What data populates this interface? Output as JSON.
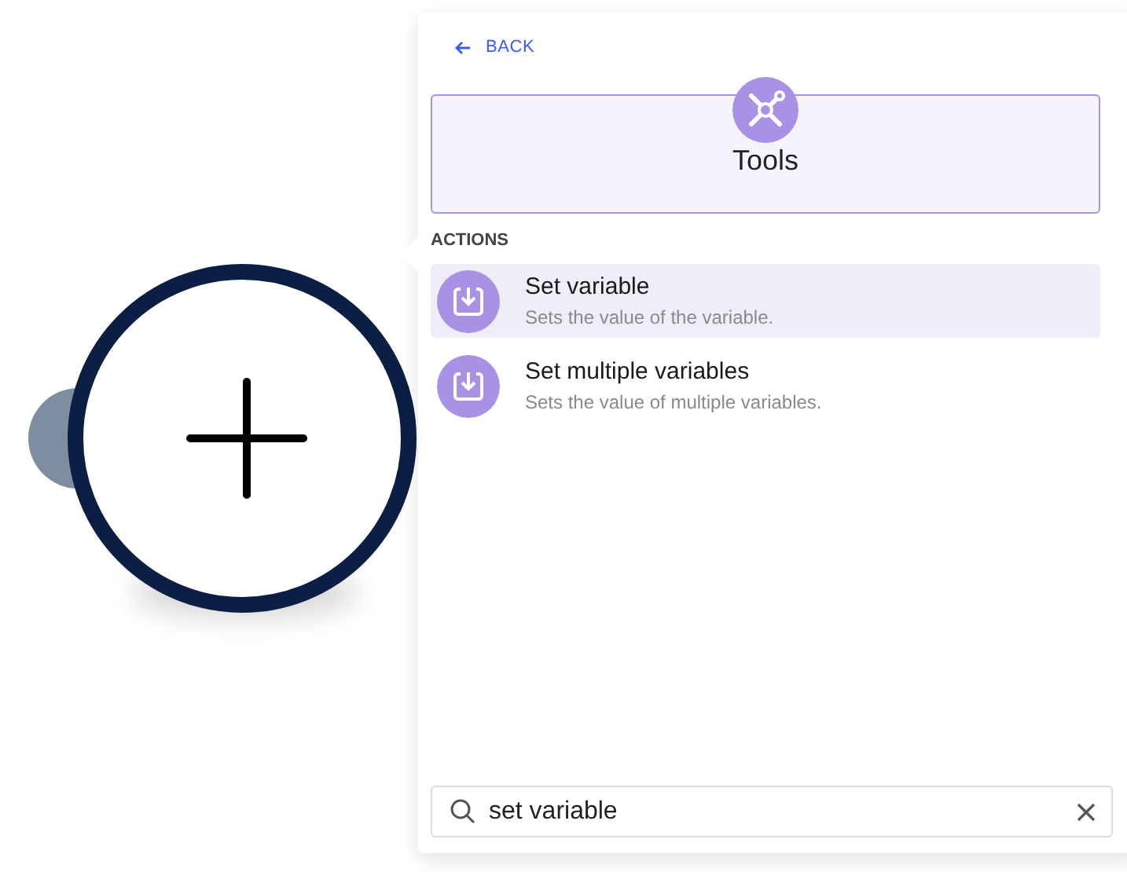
{
  "back": {
    "label": "BACK"
  },
  "category": {
    "title": "Tools"
  },
  "section_title": "ACTIONS",
  "actions": [
    {
      "title": "Set variable",
      "description": "Sets the value of the variable.",
      "selected": true
    },
    {
      "title": "Set multiple variables",
      "description": "Sets the value of multiple variables.",
      "selected": false
    }
  ],
  "search": {
    "value": "set variable"
  }
}
